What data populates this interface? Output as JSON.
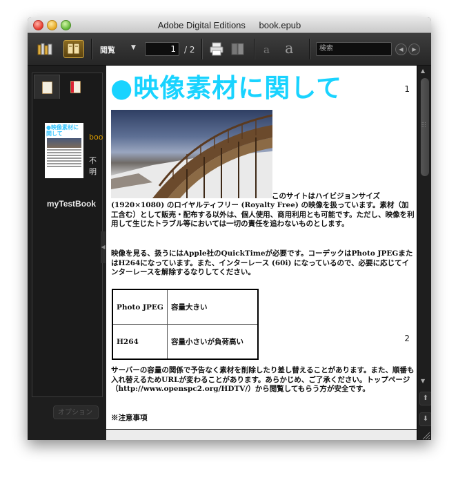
{
  "window": {
    "app_name": "Adobe Digital Editions",
    "file_name": "book.epub"
  },
  "toolbar": {
    "view_label": "閲覧",
    "current_page": "1",
    "total_pages": "/ 2",
    "font_small_label": "a",
    "font_large_label": "a",
    "search_placeholder": "検索",
    "icons": {
      "library": "library-icon",
      "reading_view": "book-view-icon",
      "print": "printer-icon",
      "bookmark": "bookmark-icon",
      "prev": "chevron-left-icon",
      "next": "chevron-right-icon"
    }
  },
  "sidebar": {
    "book_meta_title": "boo",
    "book_meta_author": "不明",
    "book_name": "myTestBook",
    "thumbnail_title": "●映像素材に関して",
    "options_button": "オプション"
  },
  "content": {
    "heading": "●映像素材に関して",
    "page1_number": "1",
    "page2_number": "2",
    "para1_inline": "このサイトはハイビジョンサイズ",
    "para1_rest": "(1920×1080) のロイヤルティフリー (Royalty Free) の映像を扱っています。素材（加工含む）として販売・配布する以外は、個人使用、商用利用とも可能です。ただし、映像を利用して生じたトラブル等においては一切の責任を追わないものとします。",
    "para2": "映像を見る、扱うにはApple社のQuickTimeが必要です。コーデックはPhoto JPEGまたはH264になっています。また、インターレース (60i) になっているので、必要に応じてインターレースを解除するなりしてください。",
    "table": [
      {
        "codec": "Photo JPEG",
        "note": "容量大きい"
      },
      {
        "codec": "H264",
        "note": "容量小さいが負荷高い"
      }
    ],
    "para3": "サーバーの容量の関係で予告なく素材を削除したり差し替えることがあります。また、順番も入れ替えるためURLが変わることがあります。あらかじめ、ご了承ください。トップページ（http://www.openspc2.org/HDTV/）から閲覧してもらう方が安全です。",
    "para4": "※注意事項"
  },
  "colors": {
    "heading_accent": "#19d3ff",
    "meta_orange": "#e0a000"
  }
}
